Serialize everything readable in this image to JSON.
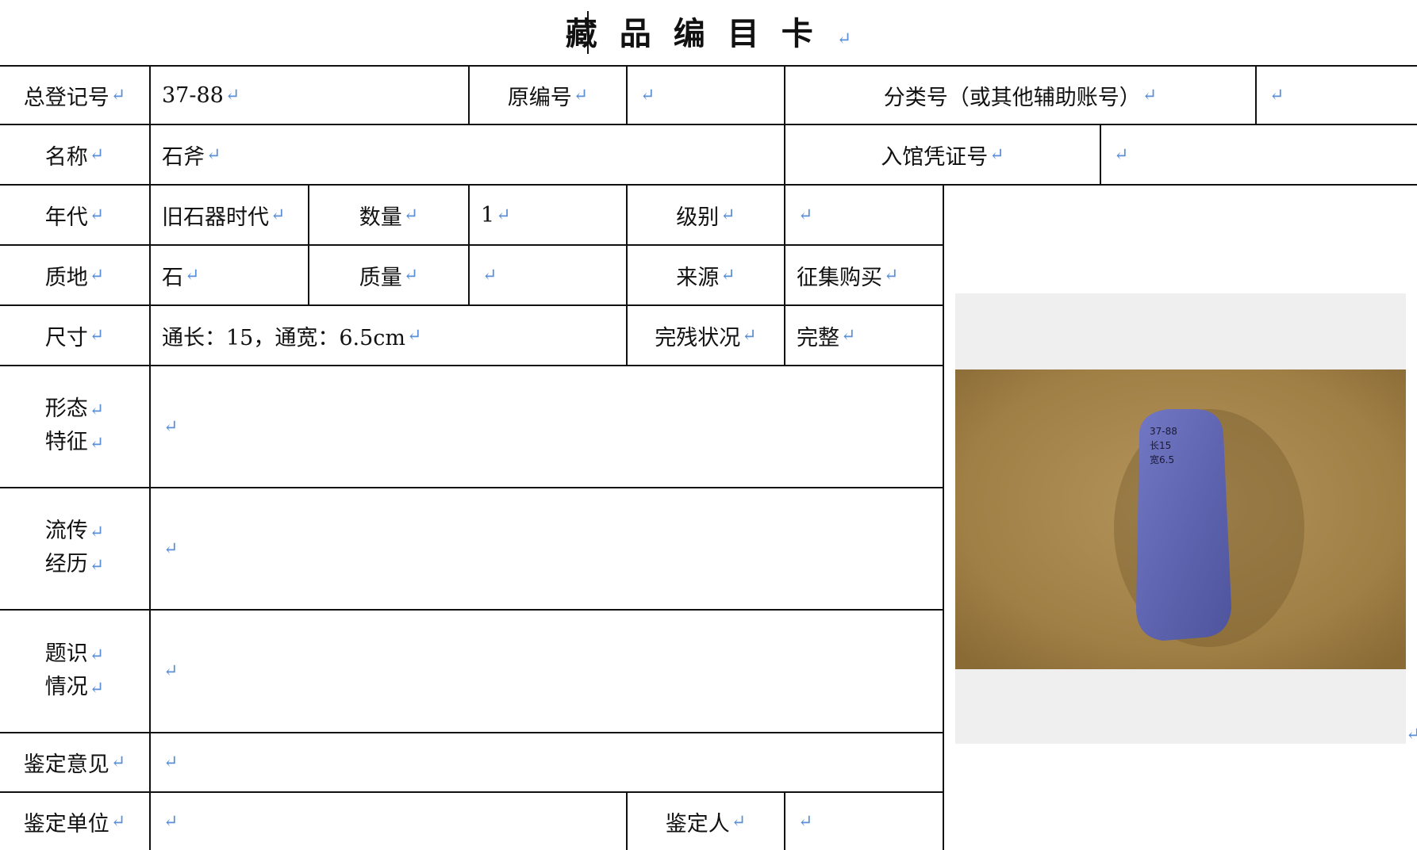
{
  "title": "藏品编目卡",
  "return_mark": "↵",
  "fields": {
    "reg_no": {
      "label": "总登记号",
      "value": "37-88"
    },
    "orig_no": {
      "label": "原编号",
      "value": ""
    },
    "class_no": {
      "label": "分类号（或其他辅助账号）",
      "value": ""
    },
    "name": {
      "label": "名称",
      "value": "石斧"
    },
    "entry_no": {
      "label": "入馆凭证号",
      "value": ""
    },
    "era": {
      "label": "年代",
      "value": "旧石器时代"
    },
    "quantity": {
      "label": "数量",
      "value": "1"
    },
    "grade": {
      "label": "级别",
      "value": ""
    },
    "material": {
      "label": "质地",
      "value": "石"
    },
    "weight": {
      "label": "质量",
      "value": ""
    },
    "source": {
      "label": "来源",
      "value": "征集购买"
    },
    "size": {
      "label": "尺寸",
      "value": "通长：15，通宽：6.5cm"
    },
    "condition": {
      "label": "完残状况",
      "value": "完整"
    },
    "form": {
      "label1": "形态",
      "label2": "特征",
      "value": ""
    },
    "history": {
      "label1": "流传",
      "label2": "经历",
      "value": ""
    },
    "inscription": {
      "label1": "题识",
      "label2": "情况",
      "value": ""
    },
    "opinion": {
      "label": "鉴定意见",
      "value": ""
    },
    "unit": {
      "label": "鉴定单位",
      "value": ""
    },
    "appraiser": {
      "label": "鉴定人",
      "value": ""
    }
  },
  "photo": {
    "alt": "stone-axe-photo",
    "tag_lines": [
      "37-88",
      "长15",
      "宽6.5"
    ],
    "colors": {
      "background": "#a7884e",
      "stone": "#6a70b8",
      "frame": "#efefef"
    }
  }
}
